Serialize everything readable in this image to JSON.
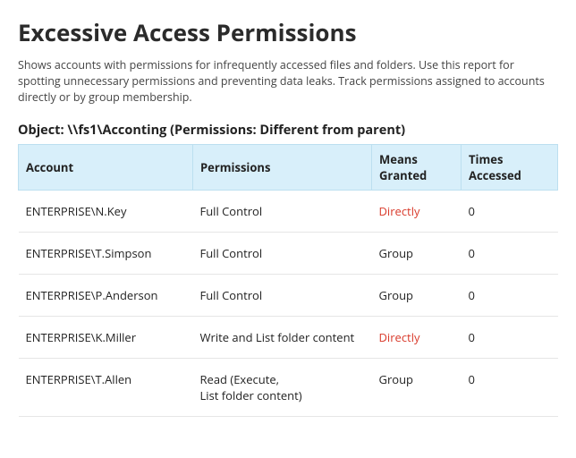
{
  "title": "Excessive Access Permissions",
  "description": "Shows accounts with permissions for infrequently accessed files and folders. Use this report for spotting unnecessary permissions and preventing data leaks. Track permissions assigned to accounts directly or by group membership.",
  "object_line": "Object: \\\\fs1\\Acconting (Permissions: Different from parent)",
  "columns": {
    "account": "Account",
    "permissions": "Permissions",
    "means": "Means Granted",
    "times": "Times Accessed"
  },
  "rows": [
    {
      "account": "ENTERPRISE\\N.Key",
      "permissions": "Full Control",
      "means": "Directly",
      "means_direct": true,
      "times": "0"
    },
    {
      "account": "ENTERPRISE\\T.Simpson",
      "permissions": "Full Control",
      "means": "Group",
      "means_direct": false,
      "times": "0"
    },
    {
      "account": "ENTERPRISE\\P.Anderson",
      "permissions": "Full Control",
      "means": "Group",
      "means_direct": false,
      "times": "0"
    },
    {
      "account": "ENTERPRISE\\K.Miller",
      "permissions": "Write and List folder content",
      "means": "Directly",
      "means_direct": true,
      "times": "0"
    },
    {
      "account": "ENTERPRISE\\T.Allen",
      "permissions": "Read (Execute,",
      "permissions_line2": "List folder content)",
      "means": "Group",
      "means_direct": false,
      "times": "0"
    }
  ]
}
